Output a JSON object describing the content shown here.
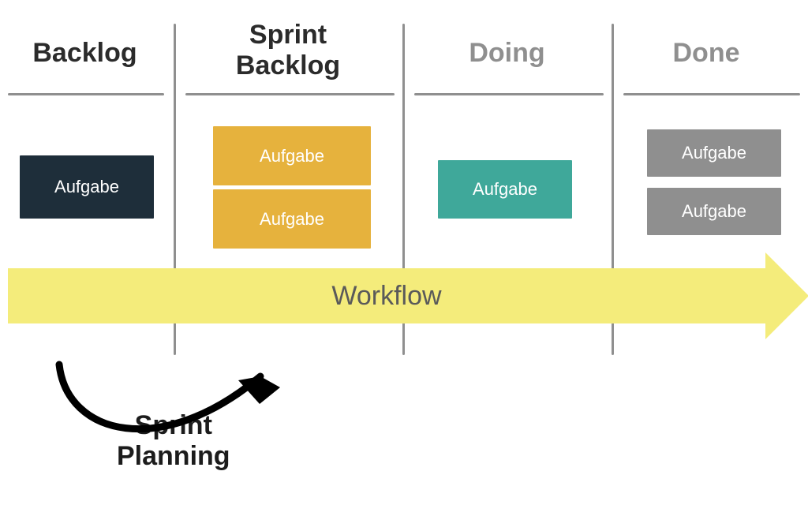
{
  "columns": {
    "backlog": {
      "label": "Backlog",
      "active": true
    },
    "sprint_backlog": {
      "label": "Sprint\nBacklog",
      "active": true
    },
    "doing": {
      "label": "Doing",
      "active": false
    },
    "done": {
      "label": "Done",
      "active": false
    }
  },
  "cards": {
    "backlog_1": "Aufgabe",
    "sprint_1": "Aufgabe",
    "sprint_2": "Aufgabe",
    "doing_1": "Aufgabe",
    "done_1": "Aufgabe",
    "done_2": "Aufgabe"
  },
  "workflow_label": "Workflow",
  "sprint_planning_label": "Sprint\nPlanning",
  "colors": {
    "dark": "#1e2e3a",
    "gold": "#e6b23d",
    "teal": "#3fa89a",
    "grey": "#8f8f8f",
    "yellow": "#f4ec7b"
  }
}
